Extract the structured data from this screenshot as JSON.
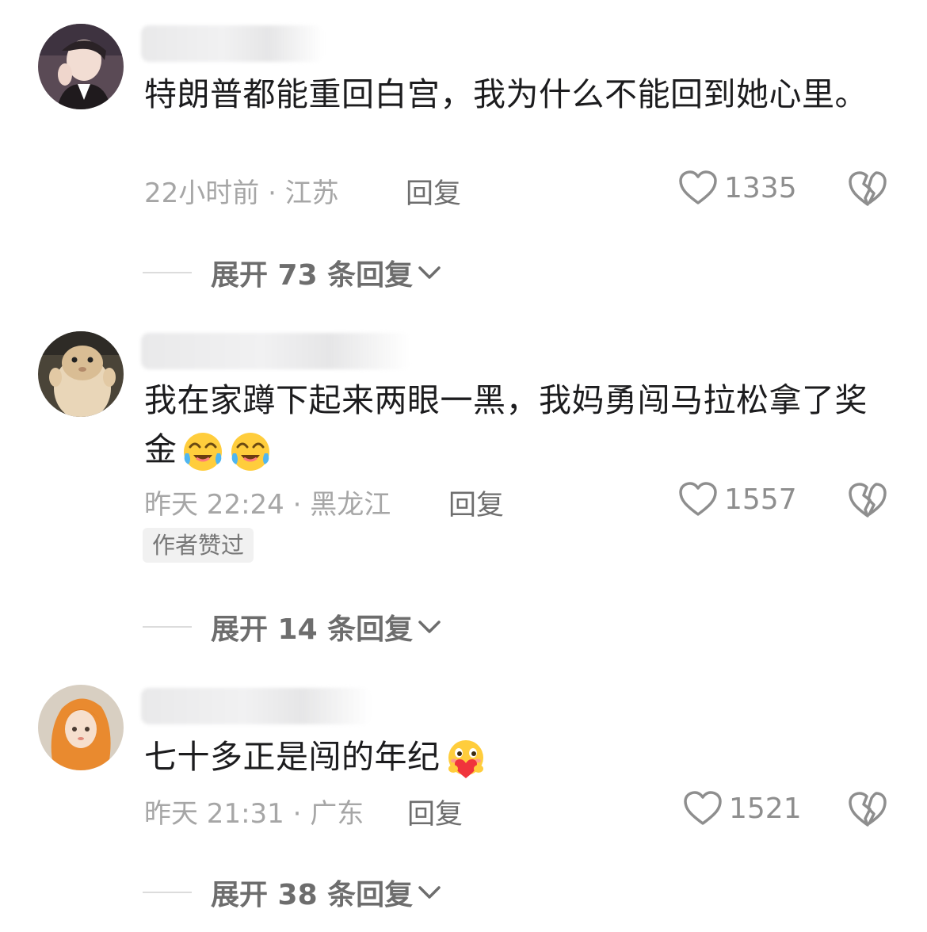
{
  "comments": [
    {
      "text": "特朗普都能重回白宫，我为什么不能回到她心里。",
      "time": "22小时前 · 江苏",
      "reply": "回复",
      "likes": "1335",
      "expand": "展开 73 条回复",
      "avatar_icon": "avatar-young-man-icon"
    },
    {
      "text": "我在家蹲下起来两眼一黑，我妈勇闯马拉松拿了奖金",
      "emojis": [
        "crying-laughing-emoji",
        "crying-laughing-emoji"
      ],
      "time": "昨天 22:24 · 黑龙江",
      "reply": "回复",
      "likes": "1557",
      "badge": "作者赞过",
      "expand": "展开 14 条回复",
      "avatar_icon": "avatar-hamster-icon"
    },
    {
      "text": "七十多正是闯的年纪",
      "emojis": [
        "heart-hug-emoji"
      ],
      "time": "昨天 21:31 · 广东",
      "reply": "回复",
      "likes": "1521",
      "expand": "展开 38 条回复",
      "avatar_icon": "avatar-orange-hair-girl-icon"
    }
  ],
  "colors": {
    "text": "#1c1c1e",
    "meta": "#a6a6a6",
    "reply": "#6e6e6e",
    "expand": "#6d6d6d",
    "badge_bg": "#f1f1f1"
  }
}
